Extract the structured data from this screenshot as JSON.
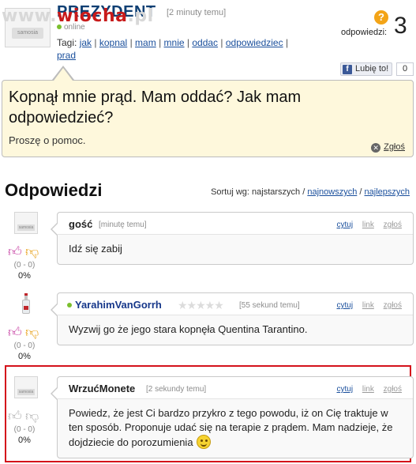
{
  "watermark": {
    "prefix": "www.",
    "brand": "wiocha",
    "suffix": ".pl"
  },
  "question": {
    "author": "PREZYDENT",
    "time": "[2 minuty temu]",
    "status": "online",
    "tags_label": "Tagi:",
    "tags": [
      "jak",
      "kopnal",
      "mam",
      "mnie",
      "oddac",
      "odpowiedziec",
      "prad"
    ],
    "answers_label": "odpowiedzi:",
    "answers_count": "3",
    "like_label": "Lubię to!",
    "like_count": "0",
    "title": "Kopnął mnie prąd. Mam oddać? Jak mam odpowiedzieć?",
    "body": "Proszę o pomoc.",
    "report_label": "Zgłoś"
  },
  "answers_section": {
    "title": "Odpowiedzi",
    "sort_label": "Sortuj wg: najstarszych /",
    "sort_newest": "najnowszych",
    "sort_sep": "/",
    "sort_best": "najlepszych"
  },
  "answers": [
    {
      "author": "gość",
      "time": "[minutę temu]",
      "text": "Idź się zabij",
      "votes": "(0 - 0)",
      "percent": "0%",
      "cite": "cytuj",
      "link": "link",
      "flag": "zgłoś"
    },
    {
      "author": "YarahimVanGorrh",
      "status": "online",
      "stars": "★★★★★",
      "time": "[55 sekund temu]",
      "text": "Wyzwij go że jego stara kopnęła Quentina Tarantino.",
      "votes": "(0 - 0)",
      "percent": "0%",
      "cite": "cytuj",
      "link": "link",
      "flag": "zgłoś"
    },
    {
      "author": "WrzućMonete",
      "time": "[2 sekundy temu]",
      "text": "Powiedz, że jest Ci bardzo przykro z tego powodu, iż on Cię traktuje w ten sposób. Proponuje udać się na terapie z prądem. Mam nadzieje, że dojdziecie do porozumienia",
      "votes": "(0 - 0)",
      "percent": "0%",
      "cite": "cytuj",
      "link": "link",
      "flag": "zgłoś"
    }
  ]
}
